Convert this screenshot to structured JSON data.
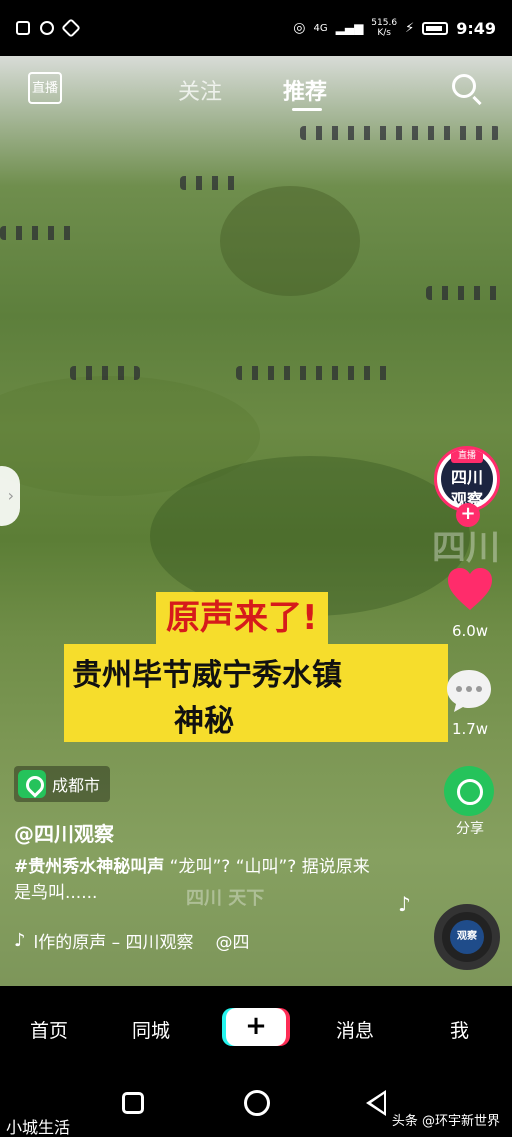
{
  "status_bar": {
    "network_speed": "515.6\nK/s",
    "network_type": "4G",
    "time": "9:49"
  },
  "top_nav": {
    "live_label": "直播",
    "tabs": [
      {
        "label": "关注",
        "active": false
      },
      {
        "label": "推荐",
        "active": true
      }
    ]
  },
  "video": {
    "caption_title": "原声来了!",
    "caption_line1": "贵州毕节威宁秀水镇",
    "caption_line2": "神秘",
    "watermark_brand": "四川",
    "watermark_bottom": "四川 天下"
  },
  "right_rail": {
    "avatar_live_badge": "直播",
    "avatar_text": "四川\n观察",
    "like_count": "6.0w",
    "comment_count": "1.7w",
    "share_label": "分享",
    "disc_text": "观察"
  },
  "info": {
    "location": "成都市",
    "author": "@四川观察",
    "hashtag": "#贵州秀水神秘叫声",
    "description": " “龙叫”? “山叫”? 据说原来是鸟叫......",
    "music": "l作的原声 – 四川观察",
    "music_tail": "@四"
  },
  "bottom_nav": {
    "items": [
      "首页",
      "同城",
      "消息",
      "我"
    ],
    "plus_label": "+"
  },
  "corner": {
    "left": "小城生活",
    "right": "头条 @环宇新世界"
  },
  "colors": {
    "accent_pink": "#ff2c6b",
    "caption_yellow": "#f6dd2c",
    "caption_red": "#d61b1b",
    "share_green": "#25c35b"
  }
}
